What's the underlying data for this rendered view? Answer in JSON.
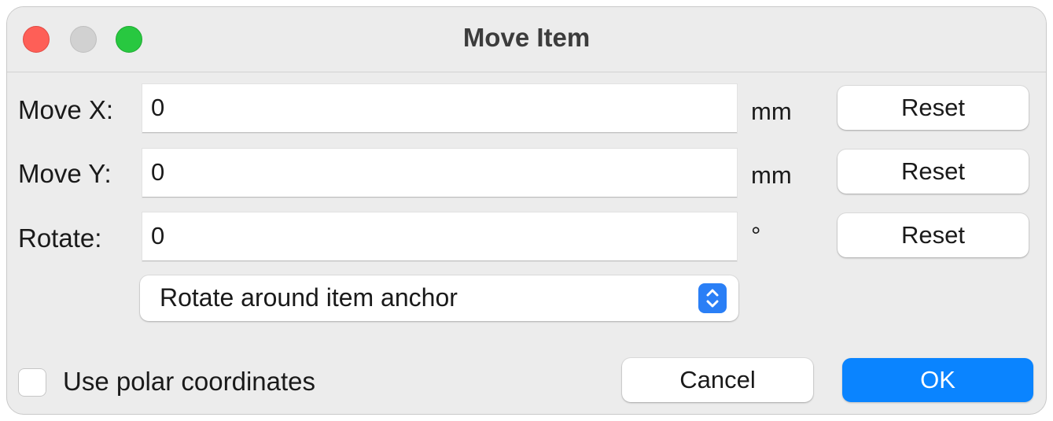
{
  "window": {
    "title": "Move Item"
  },
  "rows": [
    {
      "label": "Move X:",
      "value": "0",
      "unit": "mm",
      "reset_label": "Reset"
    },
    {
      "label": "Move Y:",
      "value": "0",
      "unit": "mm",
      "reset_label": "Reset"
    },
    {
      "label": "Rotate:",
      "value": "0",
      "unit": "°",
      "reset_label": "Reset"
    }
  ],
  "rotation_anchor": {
    "selected": "Rotate around item anchor"
  },
  "polar": {
    "label": "Use polar coordinates",
    "checked": false
  },
  "buttons": {
    "cancel": "Cancel",
    "ok": "OK"
  },
  "colors": {
    "close": "#fe5f57",
    "minimize": "#d1d1d1",
    "zoom": "#28c840",
    "accent": "#0a84ff"
  }
}
